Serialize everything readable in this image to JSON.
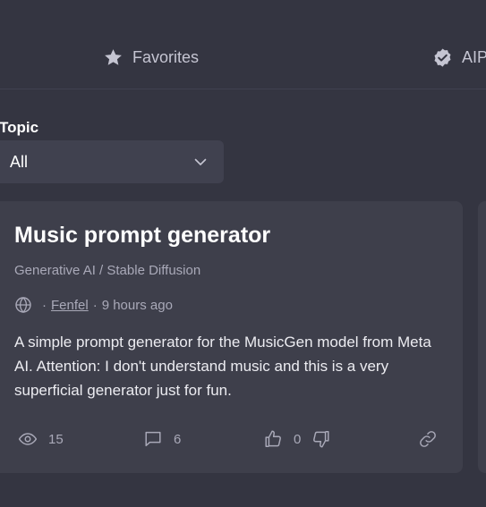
{
  "tabs": [
    {
      "label": "Favorites",
      "icon": "star-icon"
    },
    {
      "label": "AIP",
      "icon": "verified-badge-icon"
    }
  ],
  "filter": {
    "label": "Topic",
    "selected": "All"
  },
  "card": {
    "title": "Music prompt generator",
    "category": "Generative AI / Stable Diffusion",
    "visibility_icon": "globe-icon",
    "author": "Fenfel",
    "time": "9 hours ago",
    "description": "A simple prompt generator for the MusicGen model from Meta AI. Attention: I don't understand music and this is a very superficial generator just for fun.",
    "views": "15",
    "comments": "6",
    "likes": "0"
  },
  "colors": {
    "background": "#343541",
    "card": "#3e3f4b",
    "select": "#40414f",
    "muted_text": "#a9a9b8"
  }
}
